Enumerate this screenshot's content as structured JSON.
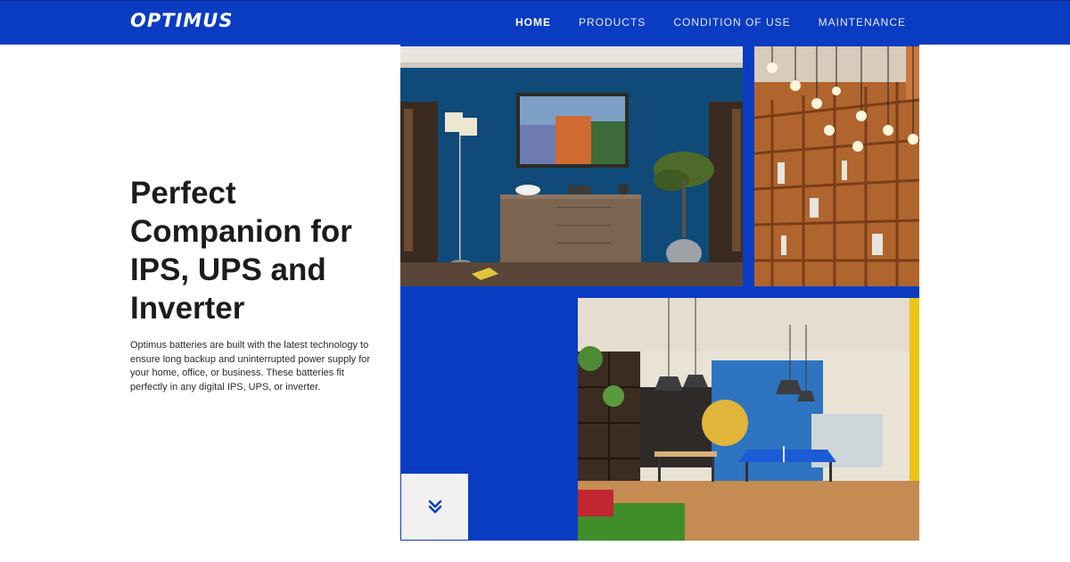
{
  "brand": {
    "logo_text": "OPTIMUS"
  },
  "nav": {
    "items": [
      {
        "label": "HOME",
        "active": true
      },
      {
        "label": "PRODUCTS",
        "active": false
      },
      {
        "label": "CONDITION OF USE",
        "active": false
      },
      {
        "label": "MAINTENANCE",
        "active": false
      }
    ]
  },
  "hero": {
    "title": "Perfect Companion for IPS, UPS and Inverter",
    "description": "Optimus batteries are built with the latest technology to ensure long backup and uninterrupted power supply for your home, office, or business. These batteries fit perfectly in any digital IPS, UPS, or inverter."
  },
  "collage": {
    "images": [
      {
        "subject": "living room with blue wall, sideboard and plant"
      },
      {
        "subject": "library shelves with hanging bulbs"
      },
      {
        "subject": "office interior with ping-pong table"
      }
    ]
  },
  "scroll_button": {
    "icon": "double-chevron-down-icon"
  },
  "colors": {
    "brand_blue": "#0a3cc2",
    "white": "#ffffff",
    "text_dark": "#1c1c1c"
  }
}
